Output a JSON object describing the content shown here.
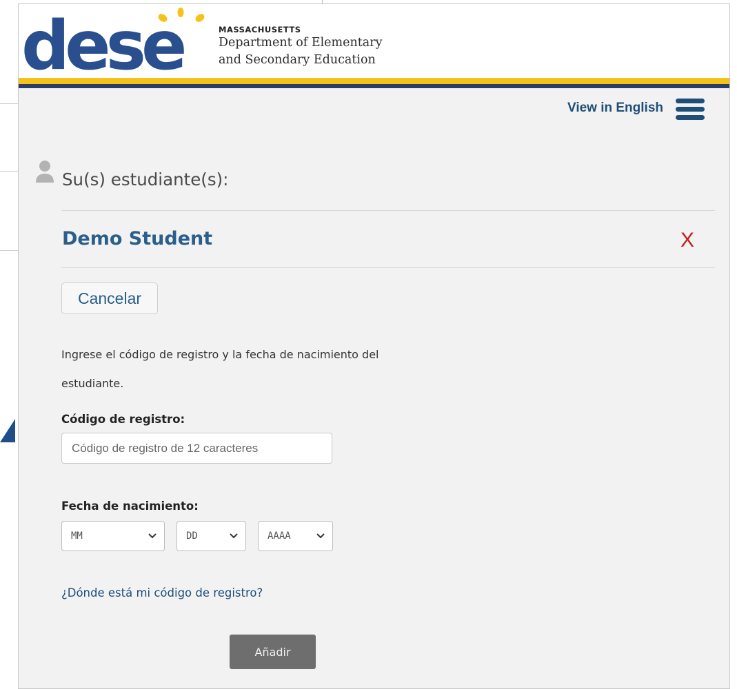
{
  "header": {
    "logo_text": "dese",
    "state": "MASSACHUSETTS",
    "agency_line1": "Department of Elementary",
    "agency_line2": "and Secondary Education",
    "brand_colors": {
      "logo_blue": "#2a4f8f",
      "gold": "#f5c21a",
      "navy": "#2a3d66"
    }
  },
  "nav": {
    "language_link": "View in English",
    "menu_icon": "hamburger-menu-icon"
  },
  "students": {
    "section_title": "Su(s) estudiante(s):",
    "section_icon": "person-icon",
    "student_name": "Demo Student",
    "remove_label": "X"
  },
  "form": {
    "cancel_label": "Cancelar",
    "instructions": "Ingrese el código de registro y la fecha de nacimiento del estudiante.",
    "code_label": "Código de registro:",
    "code_placeholder": "Código de registro de 12 caracteres",
    "dob_label": "Fecha de nacimiento:",
    "month_value": "MM",
    "day_value": "DD",
    "year_value": "AAAA",
    "help_link": "¿Dónde está mi código de registro?",
    "add_label": "Añadir"
  }
}
